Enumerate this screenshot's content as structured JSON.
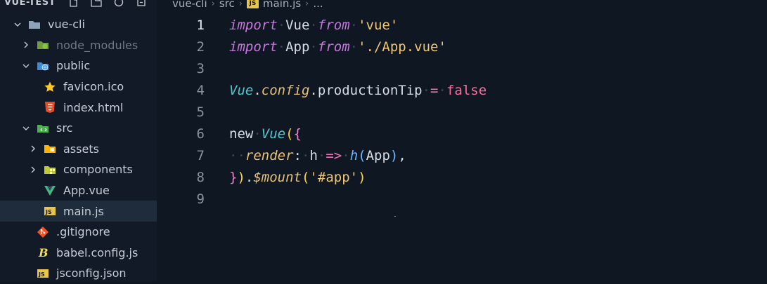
{
  "explorer": {
    "title": "VUE-TEST",
    "header_icons": [
      "new-file-icon",
      "new-folder-icon",
      "refresh-icon",
      "collapse-icon"
    ]
  },
  "tree": [
    {
      "label": "vue-cli",
      "type": "folder-open",
      "indent": 0,
      "icon": "folder-icon",
      "icon_color": "#8fa3b8"
    },
    {
      "label": "node_modules",
      "type": "folder-closed",
      "indent": 1,
      "icon": "node-modules-folder-icon",
      "icon_color": "#8bc34a",
      "dim": true
    },
    {
      "label": "public",
      "type": "folder-open",
      "indent": 1,
      "icon": "public-folder-icon",
      "icon_color": "#42a5f5"
    },
    {
      "label": "favicon.ico",
      "type": "file",
      "indent": 2,
      "icon": "star-icon",
      "icon_color": "#ffca28"
    },
    {
      "label": "index.html",
      "type": "file",
      "indent": 2,
      "icon": "html5-icon",
      "icon_color": "#e44d26"
    },
    {
      "label": "src",
      "type": "folder-open",
      "indent": 1,
      "icon": "src-folder-icon",
      "icon_color": "#4caf50"
    },
    {
      "label": "assets",
      "type": "folder-closed",
      "indent": 2,
      "icon": "assets-folder-icon",
      "icon_color": "#ffb300"
    },
    {
      "label": "components",
      "type": "folder-closed",
      "indent": 2,
      "icon": "components-folder-icon",
      "icon_color": "#c0ca33"
    },
    {
      "label": "App.vue",
      "type": "file",
      "indent": 2,
      "icon": "vue-icon",
      "icon_color": "#41b883"
    },
    {
      "label": "main.js",
      "type": "file",
      "indent": 2,
      "icon": "js-icon",
      "icon_color": "#e8c547",
      "selected": true
    },
    {
      "label": ".gitignore",
      "type": "file",
      "indent": 1,
      "icon": "git-icon",
      "icon_color": "#f4511e"
    },
    {
      "label": "babel.config.js",
      "type": "file",
      "indent": 1,
      "icon": "babel-icon",
      "icon_color": "#f5da55"
    },
    {
      "label": "jsconfig.json",
      "type": "file",
      "indent": 1,
      "icon": "js-icon",
      "icon_color": "#e8c547"
    }
  ],
  "breadcrumb": {
    "parts": [
      "vue-cli",
      "src",
      "main.js",
      "..."
    ],
    "file_badge": "JS"
  },
  "editor": {
    "active_line": 1,
    "lines": [
      {
        "n": "1",
        "text": "import Vue from 'vue'"
      },
      {
        "n": "2",
        "text": "import App from './App.vue'"
      },
      {
        "n": "3",
        "text": ""
      },
      {
        "n": "4",
        "text": "Vue.config.productionTip = false"
      },
      {
        "n": "5",
        "text": ""
      },
      {
        "n": "6",
        "text": "new Vue({"
      },
      {
        "n": "7",
        "text": "  render: h => h(App),"
      },
      {
        "n": "8",
        "text": "}).$mount('#app')"
      },
      {
        "n": "9",
        "text": ""
      }
    ],
    "tokens": {
      "import": "import",
      "from": "from",
      "vue": "Vue",
      "vue_str": "'vue'",
      "app": "App",
      "app_str": "'./App.vue'",
      "config": "config",
      "productionTip": "productionTip",
      "eq": "=",
      "false": "false",
      "new": "new",
      "render": "render",
      "h": "h",
      "arrow": "=>",
      "mount": "$mount",
      "app_sel": "'#app'"
    }
  },
  "colors": {
    "background": "#0f1722",
    "sidebar": "#111a26",
    "selection": "#1f2c3c",
    "keyword": "#c678dd",
    "string": "#f0c674",
    "class": "#4fc6c9"
  }
}
